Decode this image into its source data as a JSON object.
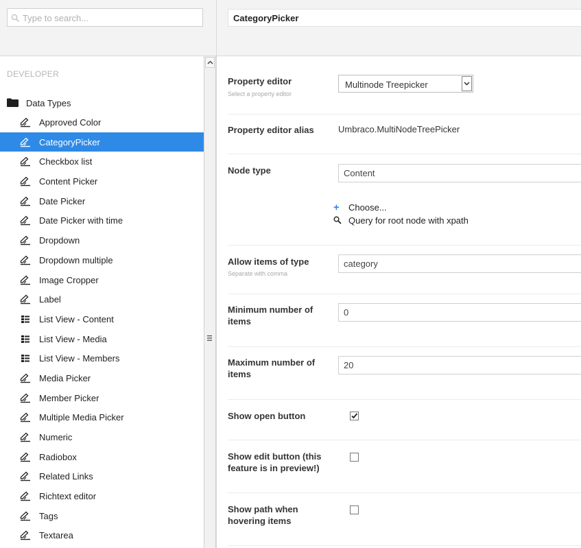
{
  "search": {
    "placeholder": "Type to search..."
  },
  "tree": {
    "section": "DEVELOPER",
    "root_label": "Data Types",
    "items": [
      {
        "label": "Approved Color",
        "icon": "edit-icon",
        "selected": false
      },
      {
        "label": "CategoryPicker",
        "icon": "edit-icon",
        "selected": true
      },
      {
        "label": "Checkbox list",
        "icon": "edit-icon",
        "selected": false
      },
      {
        "label": "Content Picker",
        "icon": "edit-icon",
        "selected": false
      },
      {
        "label": "Date Picker",
        "icon": "edit-icon",
        "selected": false
      },
      {
        "label": "Date Picker with time",
        "icon": "edit-icon",
        "selected": false
      },
      {
        "label": "Dropdown",
        "icon": "edit-icon",
        "selected": false
      },
      {
        "label": "Dropdown multiple",
        "icon": "edit-icon",
        "selected": false
      },
      {
        "label": "Image Cropper",
        "icon": "edit-icon",
        "selected": false
      },
      {
        "label": "Label",
        "icon": "edit-icon",
        "selected": false
      },
      {
        "label": "List View - Content",
        "icon": "list-view-icon",
        "selected": false
      },
      {
        "label": "List View - Media",
        "icon": "list-view-icon",
        "selected": false
      },
      {
        "label": "List View - Members",
        "icon": "list-view-icon",
        "selected": false
      },
      {
        "label": "Media Picker",
        "icon": "edit-icon",
        "selected": false
      },
      {
        "label": "Member Picker",
        "icon": "edit-icon",
        "selected": false
      },
      {
        "label": "Multiple Media Picker",
        "icon": "edit-icon",
        "selected": false
      },
      {
        "label": "Numeric",
        "icon": "edit-icon",
        "selected": false
      },
      {
        "label": "Radiobox",
        "icon": "edit-icon",
        "selected": false
      },
      {
        "label": "Related Links",
        "icon": "edit-icon",
        "selected": false
      },
      {
        "label": "Richtext editor",
        "icon": "edit-icon",
        "selected": false
      },
      {
        "label": "Tags",
        "icon": "edit-icon",
        "selected": false
      },
      {
        "label": "Textarea",
        "icon": "edit-icon",
        "selected": false
      }
    ]
  },
  "header": {
    "name_value": "CategoryPicker"
  },
  "form": {
    "property_editor": {
      "label": "Property editor",
      "desc": "Select a property editor",
      "value": "Multinode Treepicker"
    },
    "alias": {
      "label": "Property editor alias",
      "value": "Umbraco.MultiNodeTreePicker"
    },
    "node_type": {
      "label": "Node type",
      "value": "Content",
      "choose": "Choose...",
      "xpath": "Query for root node with xpath"
    },
    "allow_items": {
      "label": "Allow items of type",
      "desc": "Separate with comma",
      "value": "category"
    },
    "min_items": {
      "label": "Minimum number of items",
      "value": "0"
    },
    "max_items": {
      "label": "Maximum number of items",
      "value": "20"
    },
    "show_open": {
      "label": "Show open button",
      "checked": true
    },
    "show_edit": {
      "label": "Show edit button (this feature is in preview!)",
      "checked": false
    },
    "show_path": {
      "label": "Show path when hovering items",
      "checked": false
    }
  },
  "colors": {
    "accent": "#2e8ae6",
    "panel_bg": "#f3f3f3"
  }
}
